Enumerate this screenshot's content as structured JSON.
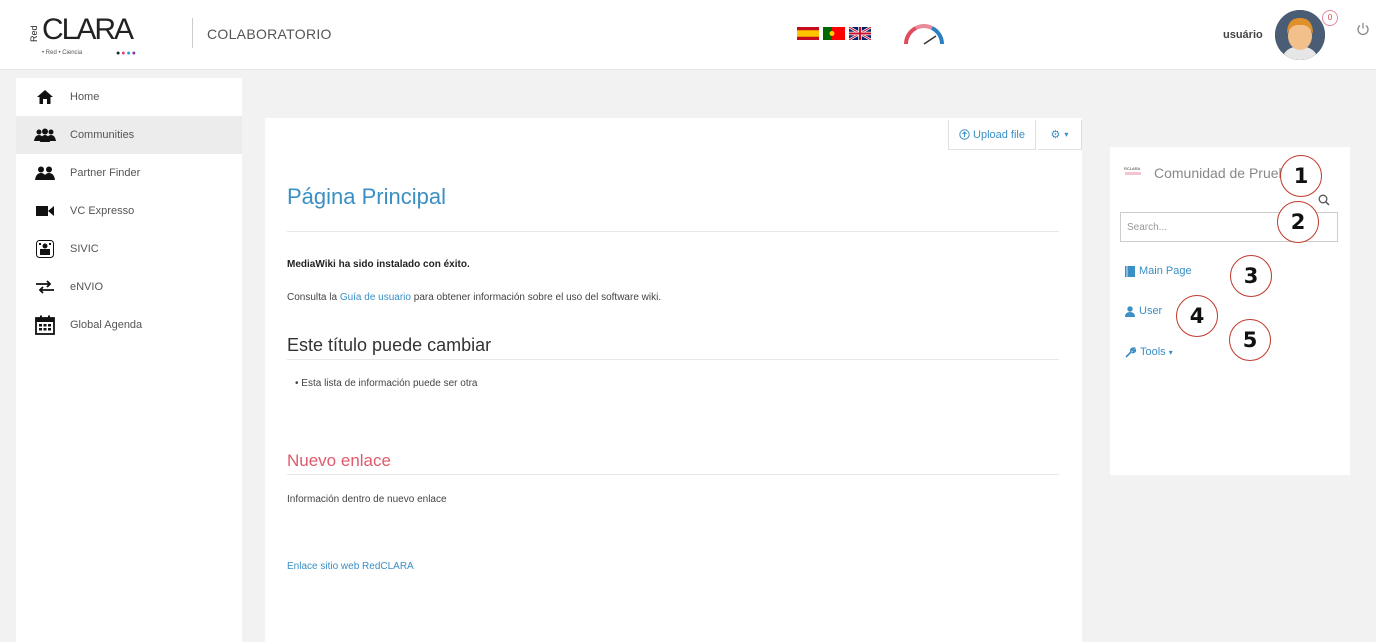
{
  "header": {
    "logo_text": "CLARA",
    "logo_red": "Red",
    "logo_sub": "• Red • Ciencia",
    "app_title": "COLABORATORIO",
    "languages": [
      "es-flag-icon",
      "pt-flag-icon",
      "uk-flag-icon"
    ],
    "username": "usuário",
    "notification_count": "0"
  },
  "sidebar": {
    "items": [
      {
        "label": "Home",
        "icon": "home-icon"
      },
      {
        "label": "Communities",
        "icon": "communities-icon"
      },
      {
        "label": "Partner Finder",
        "icon": "partner-finder-icon"
      },
      {
        "label": "VC Expresso",
        "icon": "video-camera-icon"
      },
      {
        "label": "SIVIC",
        "icon": "sivic-icon"
      },
      {
        "label": "eNVIO",
        "icon": "transfer-icon"
      },
      {
        "label": "Global Agenda",
        "icon": "calendar-icon"
      }
    ]
  },
  "main": {
    "upload_label": "Upload file",
    "page_title": "Página Principal",
    "bold_line": "MediaWiki ha sido instalado con éxito.",
    "consult_pre": "Consulta la ",
    "consult_link": "Guía de usuario",
    "consult_post": " para obtener información sobre el uso del software wiki.",
    "heading2": "Este título puede cambiar",
    "bullet": "Esta lista de información puede ser otra",
    "heading_red": "Nuevo enlace",
    "info": "Información dentro de nuevo enlace",
    "weblink": "Enlace sitio web RedCLARA"
  },
  "right_panel": {
    "community_title": "Comunidad de Prueba",
    "search_placeholder": "Search...",
    "main_page": "Main Page",
    "user": "User",
    "tools": "Tools"
  },
  "callouts": [
    "1",
    "2",
    "3",
    "4",
    "5"
  ],
  "colors": {
    "link": "#3a8fc4",
    "red_heading": "#e05a6d",
    "callout_border": "#c0392b"
  }
}
